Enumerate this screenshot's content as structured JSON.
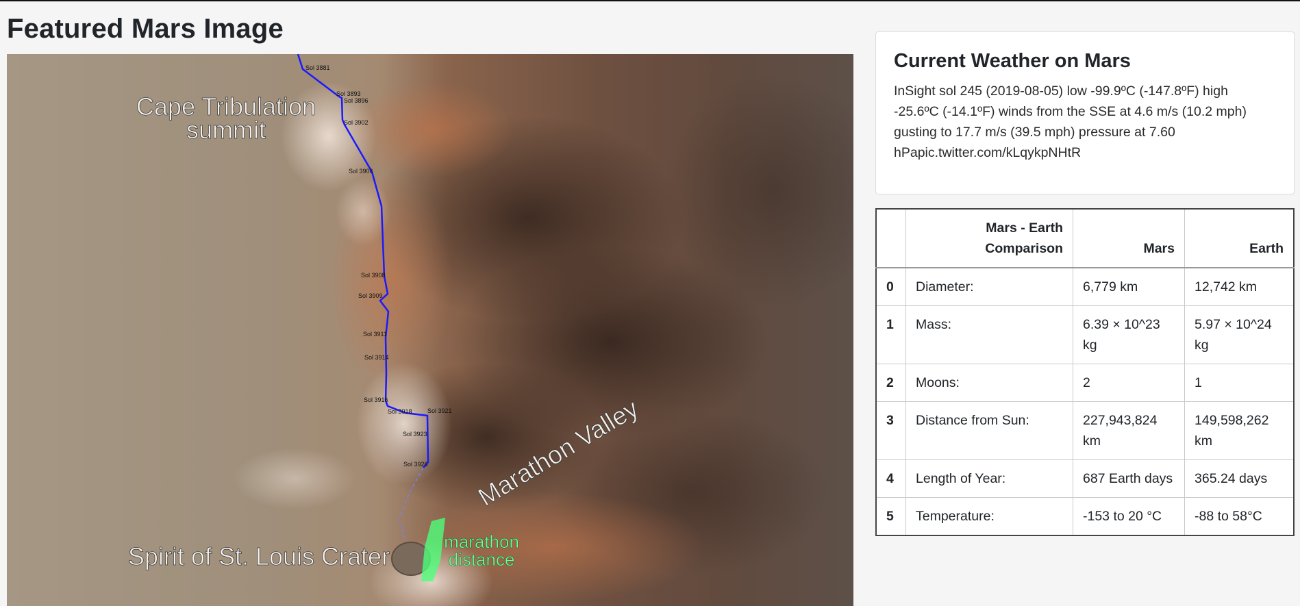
{
  "page_title": "Featured Mars Image",
  "featured_image": {
    "labels": {
      "summit_line1": "Cape Tribulation",
      "summit_line2": "summit",
      "valley": "Marathon Valley",
      "crater": "Spirit of St. Louis Crater",
      "marathon_line1": "marathon",
      "marathon_line2": "distance"
    },
    "sols": [
      "Sol 3881",
      "Sol 3893",
      "Sol 3896",
      "Sol 3902",
      "Sol 3906",
      "Sol 3908",
      "Sol 3909",
      "Sol 3911",
      "Sol 3914",
      "Sol 3916",
      "Sol 3918",
      "Sol 3921",
      "Sol 3923",
      "Sol 3926"
    ],
    "colors": {
      "traverse": "#1a1aff",
      "marathon_area": "#4dff7a"
    }
  },
  "weather": {
    "title": "Current Weather on Mars",
    "text": "InSight sol 245 (2019-08-05) low -99.9ºC (-147.8ºF) high -25.6ºC (-14.1ºF) winds from the SSE at 4.6 m/s (10.2 mph) gusting to 17.7 m/s (39.5 mph) pressure at 7.60 hPapic.twitter.com/kLqykpNHtR"
  },
  "facts_table": {
    "headers": {
      "index": "",
      "comparison": "Mars - Earth Comparison",
      "mars": "Mars",
      "earth": "Earth"
    },
    "rows": [
      {
        "index": "0",
        "label": "Diameter:",
        "mars": "6,779 km",
        "earth": "12,742 km"
      },
      {
        "index": "1",
        "label": "Mass:",
        "mars": "6.39 × 10^23 kg",
        "earth": "5.97 × 10^24 kg"
      },
      {
        "index": "2",
        "label": "Moons:",
        "mars": "2",
        "earth": "1"
      },
      {
        "index": "3",
        "label": "Distance from Sun:",
        "mars": "227,943,824 km",
        "earth": "149,598,262 km"
      },
      {
        "index": "4",
        "label": "Length of Year:",
        "mars": "687 Earth days",
        "earth": "365.24 days"
      },
      {
        "index": "5",
        "label": "Temperature:",
        "mars": "-153 to 20 °C",
        "earth": "-88 to 58°C"
      }
    ]
  }
}
